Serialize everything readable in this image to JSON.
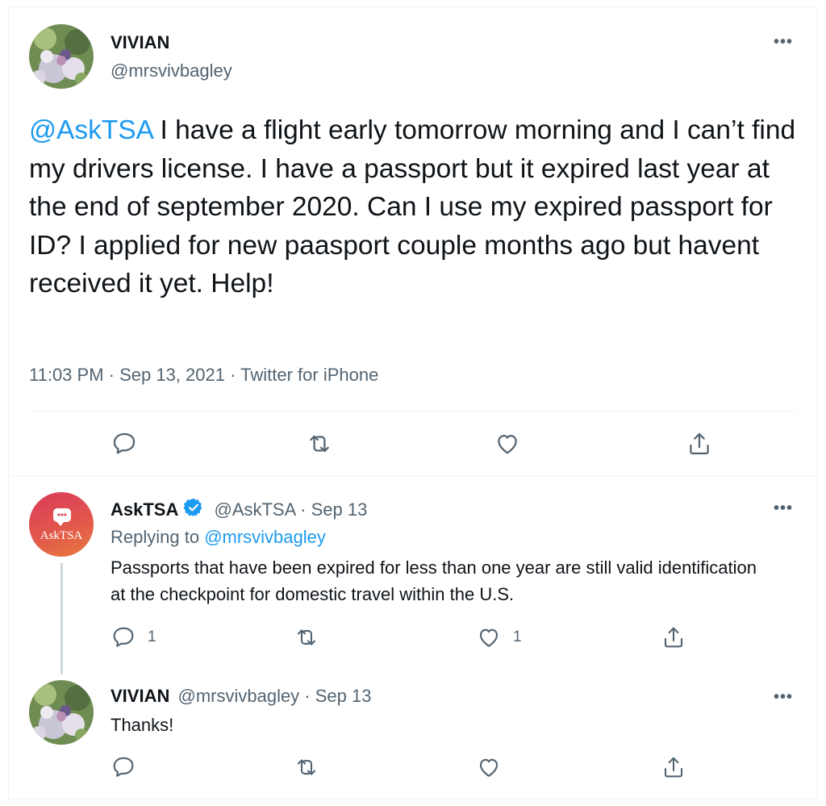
{
  "main_tweet": {
    "author_name": "VIVIAN",
    "author_handle": "@mrsvivbagley",
    "avatar_icon": "flower-avatar",
    "more_label": "•••",
    "mention": "@AskTSA",
    "text": " I have a flight early tomorrow morning and I can’t find my drivers license. I have a passport but it expired last year at the end of september 2020. Can I use my  expired passport for ID? I applied for new paasport couple months ago but havent received it yet. Help!",
    "meta": "11:03 PM · Sep 13, 2021 · Twitter for iPhone",
    "actions": [
      "reply-icon",
      "retweet-icon",
      "like-icon",
      "share-icon"
    ]
  },
  "reply_tsa": {
    "author_name": "AskTSA",
    "author_handle": "@AskTSA · Sep 13",
    "avatar_text": "AskTSA",
    "verified_icon": "verified-badge-icon",
    "more_label": "•••",
    "replying_prefix": "Replying to ",
    "replying_handle": "@mrsvivbagley",
    "text": "Passports that have been expired for less than one year are still valid identification at the checkpoint for domestic travel within the U.S.",
    "reply_count": "1",
    "like_count": "1"
  },
  "reply_vivian": {
    "author_name": "VIVIAN",
    "author_handle": "@mrsvivbagley · Sep 13",
    "more_label": "•••",
    "text": "Thanks!"
  },
  "colors": {
    "accent": "#1d9bf0",
    "text": "#0f1419",
    "secondary": "#536471",
    "tsa_gradient_start": "#d93b5b",
    "tsa_gradient_end": "#e67a3d"
  }
}
